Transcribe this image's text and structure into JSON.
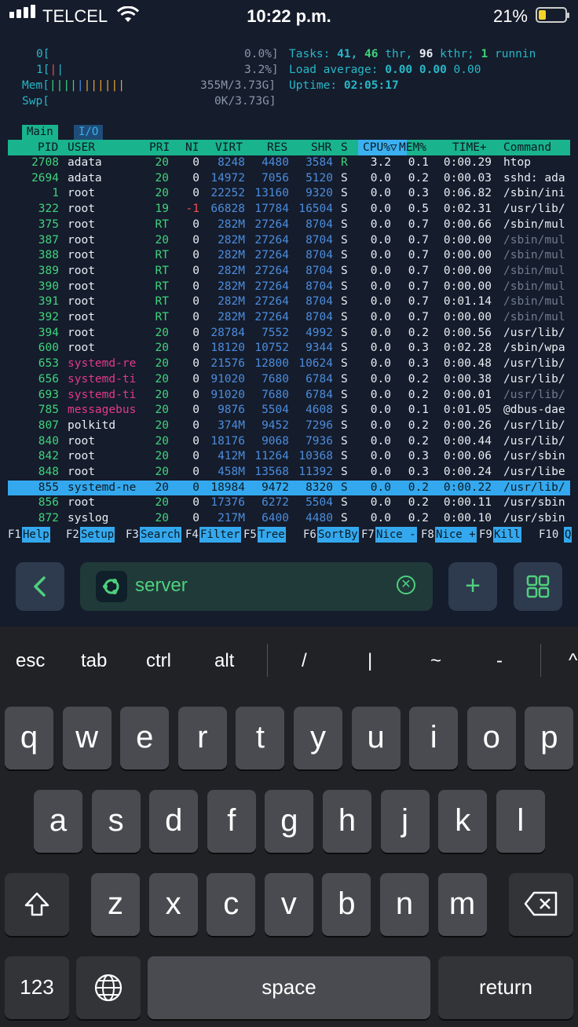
{
  "status_bar": {
    "carrier": "TELCEL",
    "time": "10:22 p.m.",
    "battery": "21%"
  },
  "htop": {
    "cpu0": {
      "label": "0[",
      "value": "0.0%]"
    },
    "cpu1": {
      "label": "1[",
      "bars": "|",
      "value": "3.2%]"
    },
    "mem": {
      "label": "Mem[",
      "value": "355M/3.73G]"
    },
    "swp": {
      "label": "Swp[",
      "value": "0K/3.73G]"
    },
    "tasks": {
      "label": "Tasks:",
      "count": "41,",
      "thr": "46",
      "thr_label": "thr,",
      "kthr": "96",
      "kthr_label": "kthr;",
      "running": "1",
      "running_label": "runnin"
    },
    "load": {
      "label": "Load average:",
      "v1": "0.00",
      "v2": "0.00",
      "v3": "0.00"
    },
    "uptime": {
      "label": "Uptime:",
      "value": "02:05:17"
    },
    "tabs": [
      "Main",
      "I/O"
    ],
    "columns": [
      "PID",
      "USER",
      "PRI",
      "NI",
      "VIRT",
      "RES",
      "SHR",
      "S",
      "CPU%▽",
      "MEM%",
      "TIME+",
      "Command"
    ],
    "processes": [
      {
        "pid": "2708",
        "user": "adata",
        "pri": "20",
        "ni": "0",
        "virt": "8248",
        "res": "4480",
        "shr": "3584",
        "s": "R",
        "cpu": "3.2",
        "mem": "0.1",
        "time": "0:00.29",
        "cmd": "htop"
      },
      {
        "pid": "2694",
        "user": "adata",
        "pri": "20",
        "ni": "0",
        "virt": "14972",
        "res": "7056",
        "shr": "5120",
        "s": "S",
        "cpu": "0.0",
        "mem": "0.2",
        "time": "0:00.03",
        "cmd": "sshd: ada"
      },
      {
        "pid": "1",
        "user": "root",
        "pri": "20",
        "ni": "0",
        "virt": "22252",
        "res": "13160",
        "shr": "9320",
        "s": "S",
        "cpu": "0.0",
        "mem": "0.3",
        "time": "0:06.82",
        "cmd": "/sbin/ini"
      },
      {
        "pid": "322",
        "user": "root",
        "pri": "19",
        "ni": "-1",
        "virt": "66828",
        "res": "17784",
        "shr": "16504",
        "s": "S",
        "cpu": "0.0",
        "mem": "0.5",
        "time": "0:02.31",
        "cmd": "/usr/lib/"
      },
      {
        "pid": "375",
        "user": "root",
        "pri": "RT",
        "ni": "0",
        "virt": "282M",
        "res": "27264",
        "shr": "8704",
        "s": "S",
        "cpu": "0.0",
        "mem": "0.7",
        "time": "0:00.66",
        "cmd": "/sbin/mul"
      },
      {
        "pid": "387",
        "user": "root",
        "pri": "20",
        "ni": "0",
        "virt": "282M",
        "res": "27264",
        "shr": "8704",
        "s": "S",
        "cpu": "0.0",
        "mem": "0.7",
        "time": "0:00.00",
        "cmd": "/sbin/mul"
      },
      {
        "pid": "388",
        "user": "root",
        "pri": "RT",
        "ni": "0",
        "virt": "282M",
        "res": "27264",
        "shr": "8704",
        "s": "S",
        "cpu": "0.0",
        "mem": "0.7",
        "time": "0:00.00",
        "cmd": "/sbin/mul"
      },
      {
        "pid": "389",
        "user": "root",
        "pri": "RT",
        "ni": "0",
        "virt": "282M",
        "res": "27264",
        "shr": "8704",
        "s": "S",
        "cpu": "0.0",
        "mem": "0.7",
        "time": "0:00.00",
        "cmd": "/sbin/mul"
      },
      {
        "pid": "390",
        "user": "root",
        "pri": "RT",
        "ni": "0",
        "virt": "282M",
        "res": "27264",
        "shr": "8704",
        "s": "S",
        "cpu": "0.0",
        "mem": "0.7",
        "time": "0:00.00",
        "cmd": "/sbin/mul"
      },
      {
        "pid": "391",
        "user": "root",
        "pri": "RT",
        "ni": "0",
        "virt": "282M",
        "res": "27264",
        "shr": "8704",
        "s": "S",
        "cpu": "0.0",
        "mem": "0.7",
        "time": "0:01.14",
        "cmd": "/sbin/mul"
      },
      {
        "pid": "392",
        "user": "root",
        "pri": "RT",
        "ni": "0",
        "virt": "282M",
        "res": "27264",
        "shr": "8704",
        "s": "S",
        "cpu": "0.0",
        "mem": "0.7",
        "time": "0:00.00",
        "cmd": "/sbin/mul"
      },
      {
        "pid": "394",
        "user": "root",
        "pri": "20",
        "ni": "0",
        "virt": "28784",
        "res": "7552",
        "shr": "4992",
        "s": "S",
        "cpu": "0.0",
        "mem": "0.2",
        "time": "0:00.56",
        "cmd": "/usr/lib/"
      },
      {
        "pid": "600",
        "user": "root",
        "pri": "20",
        "ni": "0",
        "virt": "18120",
        "res": "10752",
        "shr": "9344",
        "s": "S",
        "cpu": "0.0",
        "mem": "0.3",
        "time": "0:02.28",
        "cmd": "/sbin/wpa"
      },
      {
        "pid": "653",
        "user": "systemd-re",
        "pri": "20",
        "ni": "0",
        "virt": "21576",
        "res": "12800",
        "shr": "10624",
        "s": "S",
        "cpu": "0.0",
        "mem": "0.3",
        "time": "0:00.48",
        "cmd": "/usr/lib/"
      },
      {
        "pid": "656",
        "user": "systemd-ti",
        "pri": "20",
        "ni": "0",
        "virt": "91020",
        "res": "7680",
        "shr": "6784",
        "s": "S",
        "cpu": "0.0",
        "mem": "0.2",
        "time": "0:00.38",
        "cmd": "/usr/lib/"
      },
      {
        "pid": "693",
        "user": "systemd-ti",
        "pri": "20",
        "ni": "0",
        "virt": "91020",
        "res": "7680",
        "shr": "6784",
        "s": "S",
        "cpu": "0.0",
        "mem": "0.2",
        "time": "0:00.01",
        "cmd": "/usr/lib/"
      },
      {
        "pid": "785",
        "user": "messagebus",
        "pri": "20",
        "ni": "0",
        "virt": "9876",
        "res": "5504",
        "shr": "4608",
        "s": "S",
        "cpu": "0.0",
        "mem": "0.1",
        "time": "0:01.05",
        "cmd": "@dbus-dae"
      },
      {
        "pid": "807",
        "user": "polkitd",
        "pri": "20",
        "ni": "0",
        "virt": "374M",
        "res": "9452",
        "shr": "7296",
        "s": "S",
        "cpu": "0.0",
        "mem": "0.2",
        "time": "0:00.26",
        "cmd": "/usr/lib/"
      },
      {
        "pid": "840",
        "user": "root",
        "pri": "20",
        "ni": "0",
        "virt": "18176",
        "res": "9068",
        "shr": "7936",
        "s": "S",
        "cpu": "0.0",
        "mem": "0.2",
        "time": "0:00.44",
        "cmd": "/usr/lib/"
      },
      {
        "pid": "842",
        "user": "root",
        "pri": "20",
        "ni": "0",
        "virt": "412M",
        "res": "11264",
        "shr": "10368",
        "s": "S",
        "cpu": "0.0",
        "mem": "0.3",
        "time": "0:00.06",
        "cmd": "/usr/sbin"
      },
      {
        "pid": "848",
        "user": "root",
        "pri": "20",
        "ni": "0",
        "virt": "458M",
        "res": "13568",
        "shr": "11392",
        "s": "S",
        "cpu": "0.0",
        "mem": "0.3",
        "time": "0:00.24",
        "cmd": "/usr/libe"
      },
      {
        "pid": "855",
        "user": "systemd-ne",
        "pri": "20",
        "ni": "0",
        "virt": "18984",
        "res": "9472",
        "shr": "8320",
        "s": "S",
        "cpu": "0.0",
        "mem": "0.2",
        "time": "0:00.22",
        "cmd": "/usr/lib/"
      },
      {
        "pid": "856",
        "user": "root",
        "pri": "20",
        "ni": "0",
        "virt": "17376",
        "res": "6272",
        "shr": "5504",
        "s": "S",
        "cpu": "0.0",
        "mem": "0.2",
        "time": "0:00.11",
        "cmd": "/usr/sbin"
      },
      {
        "pid": "872",
        "user": "syslog",
        "pri": "20",
        "ni": "0",
        "virt": "217M",
        "res": "6400",
        "shr": "4480",
        "s": "S",
        "cpu": "0.0",
        "mem": "0.2",
        "time": "0:00.10",
        "cmd": "/usr/sbin"
      }
    ],
    "selected_pid": "855",
    "fkeys": [
      {
        "key": "F1",
        "label": "Help"
      },
      {
        "key": "F2",
        "label": "Setup"
      },
      {
        "key": "F3",
        "label": "Search"
      },
      {
        "key": "F4",
        "label": "Filter"
      },
      {
        "key": "F5",
        "label": "Tree"
      },
      {
        "key": "F6",
        "label": "SortBy"
      },
      {
        "key": "F7",
        "label": "Nice -"
      },
      {
        "key": "F8",
        "label": "Nice +"
      },
      {
        "key": "F9",
        "label": "Kill"
      },
      {
        "key": "F10",
        "label": "Q"
      }
    ]
  },
  "toolbar": {
    "back_icon": "chevron-left-icon",
    "session_name": "server",
    "clear_icon": "clear-circle-icon",
    "add_label": "+",
    "grid_icon": "grid-icon"
  },
  "keyboard": {
    "accessory": [
      "esc",
      "tab",
      "ctrl",
      "alt",
      "/",
      "|",
      "~",
      "-",
      "^"
    ],
    "row1": [
      "q",
      "w",
      "e",
      "r",
      "t",
      "y",
      "u",
      "i",
      "o",
      "p"
    ],
    "row2": [
      "a",
      "s",
      "d",
      "f",
      "g",
      "h",
      "j",
      "k",
      "l"
    ],
    "row3": [
      "z",
      "x",
      "c",
      "v",
      "b",
      "n",
      "m"
    ],
    "num_label": "123",
    "space_label": "space",
    "return_label": "return"
  },
  "colors": {
    "bg": "#151c2c",
    "header_bar": "#19b38d",
    "selection": "#34a8ee",
    "accent_green": "#4fd07d"
  }
}
